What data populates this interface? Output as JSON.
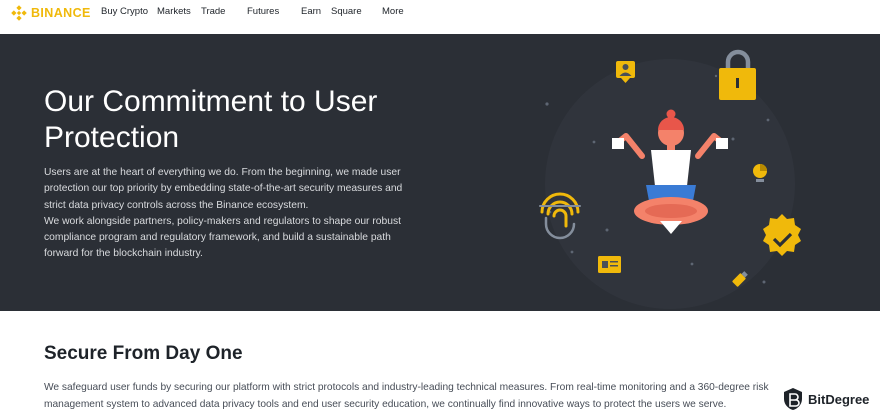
{
  "nav": {
    "logo_text": "BINANCE",
    "items": [
      "Buy Crypto",
      "Markets",
      "Trade",
      "Futures",
      "Earn",
      "Square",
      "More"
    ]
  },
  "hero": {
    "title": "Our Commitment to User Protection",
    "paragraph1": "Users are at the heart of everything we do. From the beginning, we made user protection our top priority by embedding state-of-the-art security measures and strict data privacy controls across the Binance ecosystem.",
    "paragraph2": "We work alongside partners, policy-makers and regulators to shape our robust compliance program and regulatory framework, and build a sustainable path forward for the blockchain industry."
  },
  "section": {
    "title": "Secure From Day One",
    "body": "We safeguard user funds by securing our platform with strict protocols and industry-leading technical measures. From real-time monitoring and a 360-degree risk management system to advanced data privacy tools and end user security education, we continually find innovative ways to protect the users we serve."
  },
  "watermark": {
    "text": "BitDegree"
  },
  "colors": {
    "brand": "#F0B90B",
    "hero_bg": "#2b2f36",
    "figure_skin": "#f4826a",
    "figure_pants": "#3a7bd5"
  }
}
